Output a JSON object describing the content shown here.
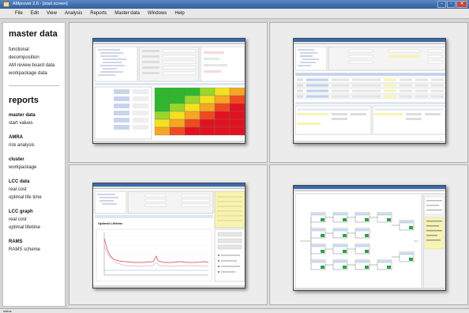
{
  "window": {
    "title": "AMprover 2.6 - [start screen]",
    "controls": {
      "minimize": "–",
      "maximize": "▫",
      "close": "✕"
    }
  },
  "menu": [
    "File",
    "Edit",
    "View",
    "Analysis",
    "Reports",
    "Master data",
    "Windows",
    "Help"
  ],
  "sidebar": {
    "master_heading": "master data",
    "master_items": [
      "functional decomposition",
      "AM review board data",
      "workpackage data"
    ],
    "reports_heading": "reports",
    "groups": [
      {
        "title": "master data",
        "items": [
          "start values"
        ]
      },
      {
        "title": "AMRA",
        "items": [
          "risk analysis"
        ]
      },
      {
        "title": "cluster",
        "items": [
          "workpackage"
        ]
      },
      {
        "title": "LCC data",
        "items": [
          "real cost",
          "optimal life time"
        ]
      },
      {
        "title": "LCC graph",
        "items": [
          "real cost",
          "optimal lifetime"
        ]
      },
      {
        "title": "RAMS",
        "items": [
          "RAMS scheme"
        ]
      }
    ]
  },
  "previews": [
    {
      "name": "risk-matrix"
    },
    {
      "name": "workpackage-table"
    },
    {
      "name": "lcc-graph",
      "heading": "Optimal Lifetime"
    },
    {
      "name": "rams-scheme"
    }
  ],
  "statusbar": {
    "text": "status"
  }
}
